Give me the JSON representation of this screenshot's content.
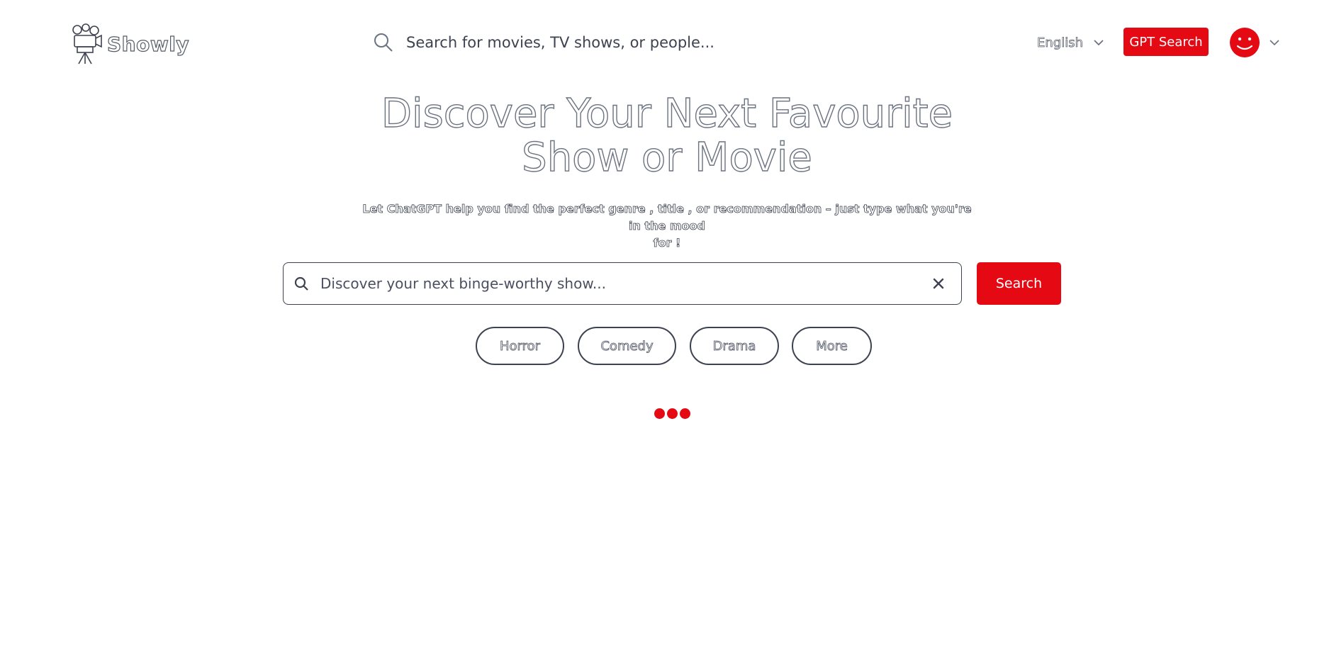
{
  "app": {
    "name": "Showly"
  },
  "header": {
    "search_placeholder": "Search for movies, TV shows, or people...",
    "language_label": "English",
    "gpt_button_label": "GPT Search"
  },
  "hero": {
    "title_line1": "Discover Your Next Favourite",
    "title_line2": "Show or Movie",
    "subtitle_line1": "Let ChatGPT help you find the perfect genre , title , or recommendation – just type what you're in the mood",
    "subtitle_line2": "for !"
  },
  "gpt_search": {
    "placeholder": "Discover your next binge-worthy show...",
    "button_label": "Search"
  },
  "genres": [
    {
      "label": "Horror"
    },
    {
      "label": "Comedy"
    },
    {
      "label": "Drama"
    },
    {
      "label": "More"
    }
  ],
  "colors": {
    "accent": "#e50914",
    "text_outline": "#3d4250"
  },
  "icons": {
    "logo": "camera-tripod-icon",
    "search": "search-icon",
    "chevron": "chevron-down-icon",
    "clear": "close-icon",
    "avatar": "smiley-avatar-icon"
  }
}
